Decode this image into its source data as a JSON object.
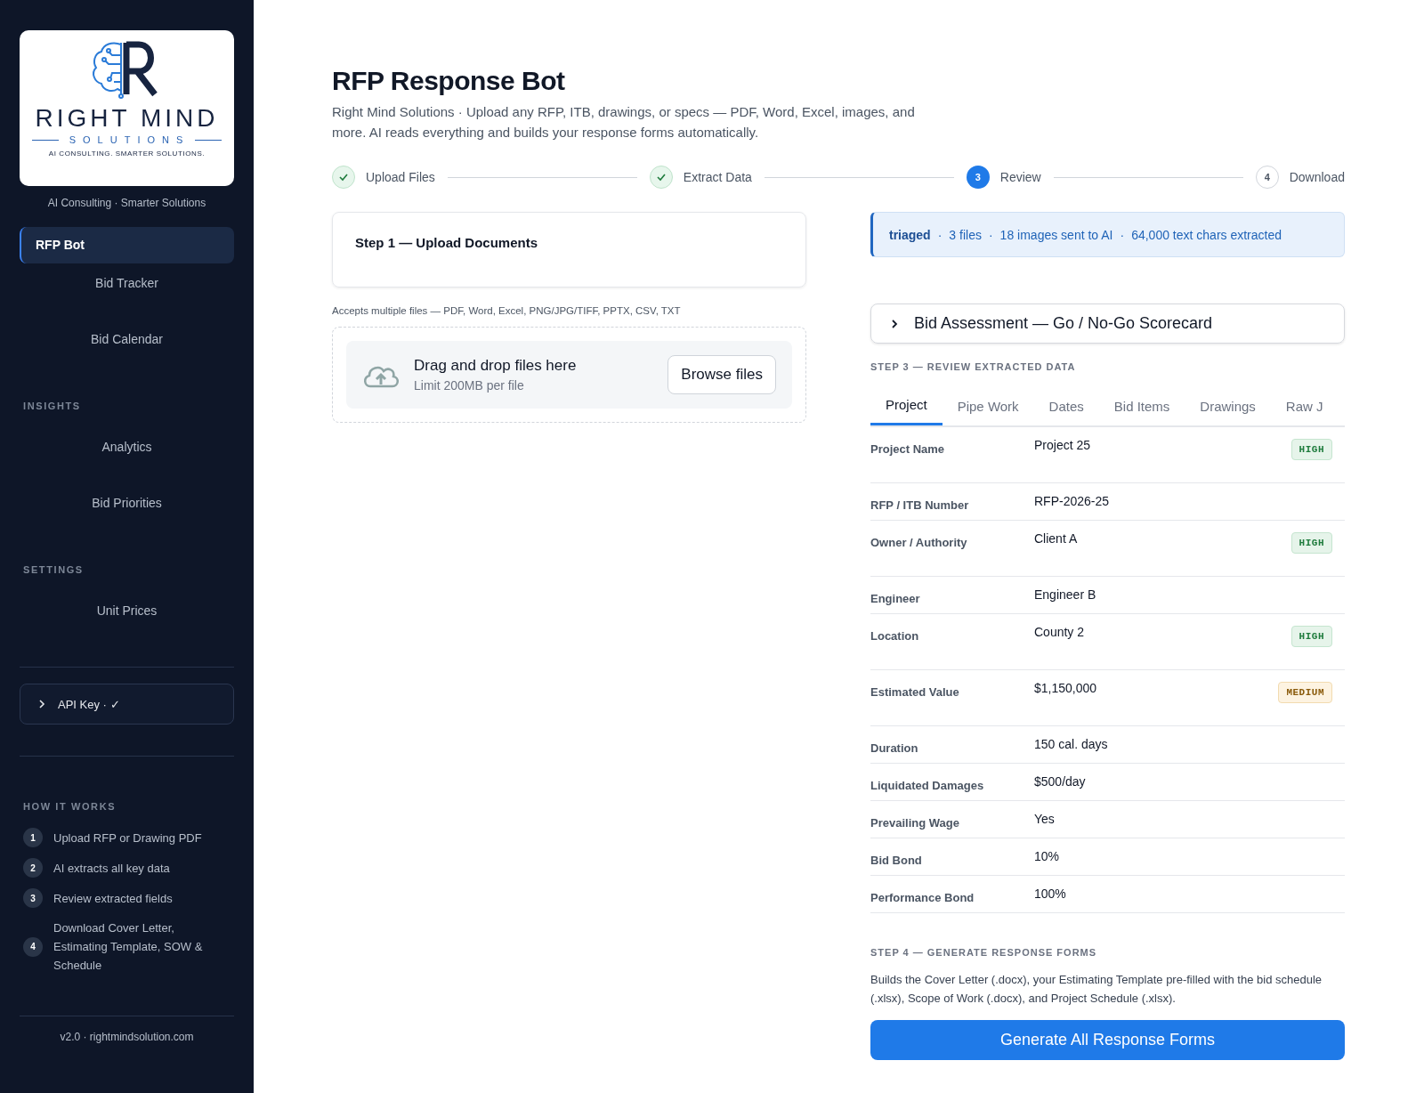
{
  "sidebar": {
    "logo": {
      "wordmark": "RIGHT MIND",
      "subtitle": "SOLUTIONS",
      "motto": "AI CONSULTING. SMARTER SOLUTIONS."
    },
    "tagline": "AI Consulting · Smarter Solutions",
    "nav": [
      {
        "label": "RFP Bot",
        "selected": true
      },
      {
        "label": "Bid Tracker",
        "selected": false
      },
      {
        "label": "Bid Calendar",
        "selected": false
      }
    ],
    "sections": [
      {
        "title": "INSIGHTS",
        "items": [
          {
            "label": "Analytics",
            "selected": false
          },
          {
            "label": "Bid Priorities",
            "selected": false
          }
        ]
      },
      {
        "title": "SETTINGS",
        "items": [
          {
            "label": "Unit Prices",
            "selected": false
          }
        ]
      }
    ],
    "api_key": {
      "label": "API Key · ✓",
      "expanded": false
    },
    "how_it_works": {
      "title": "HOW IT WORKS",
      "steps": [
        {
          "number": "1",
          "text": "Upload RFP or Drawing PDF"
        },
        {
          "number": "2",
          "text": "AI extracts all key data"
        },
        {
          "number": "3",
          "text": "Review extracted fields"
        },
        {
          "number": "4",
          "text": "Download Cover Letter, Estimating Template, SOW & Schedule"
        }
      ]
    },
    "footer": "v2.0 · rightmindsolution.com"
  },
  "main": {
    "title": "RFP Response Bot",
    "subtitle": "Right Mind Solutions · Upload any RFP, ITB, drawings, or specs — PDF, Word, Excel, images, and more. AI reads everything and builds your response forms automatically.",
    "stepper": [
      {
        "label": "Upload Files",
        "kind": "done"
      },
      {
        "label": "Extract Data",
        "kind": "done"
      },
      {
        "number": "3",
        "label": "Review",
        "kind": "current"
      },
      {
        "number": "4",
        "label": "Download",
        "kind": "pending"
      }
    ],
    "upload": {
      "heading": "Step 1 — Upload Documents",
      "accepts": "Accepts multiple files — PDF, Word, Excel, PNG/JPG/TIFF, PPTX, CSV, TXT",
      "dropzone": {
        "title": "Drag and drop files here",
        "limit": "Limit 200MB per file",
        "button": "Browse files"
      }
    },
    "status_banner": {
      "label": "triaged",
      "separator": "·",
      "items": [
        "3 files",
        "18 images sent to AI",
        "64,000 text chars extracted"
      ]
    },
    "scorecard": {
      "label": "Bid Assessment — Go / No-Go Scorecard",
      "expanded": false
    },
    "review": {
      "heading": "STEP 3 — REVIEW EXTRACTED DATA",
      "tabs": [
        {
          "label": "Project",
          "selected": true
        },
        {
          "label": "Pipe Work",
          "selected": false
        },
        {
          "label": "Dates",
          "selected": false
        },
        {
          "label": "Bid Items",
          "selected": false
        },
        {
          "label": "Drawings",
          "selected": false
        },
        {
          "label": "Raw J",
          "selected": false
        }
      ],
      "fields": [
        {
          "label": "Project Name",
          "value": "Project 25",
          "badge": {
            "text": "HIGH",
            "kind": "high"
          }
        },
        {
          "label": "RFP / ITB Number",
          "value": "RFP-2026-25"
        },
        {
          "label": "Owner / Authority",
          "value": "Client A",
          "badge": {
            "text": "HIGH",
            "kind": "high"
          }
        },
        {
          "label": "Engineer",
          "value": "Engineer B"
        },
        {
          "label": "Location",
          "value": "County 2",
          "badge": {
            "text": "HIGH",
            "kind": "high"
          }
        },
        {
          "label": "Estimated Value",
          "value": "$1,150,000",
          "badge": {
            "text": "MEDIUM",
            "kind": "medium"
          }
        },
        {
          "label": "Duration",
          "value": "150 cal. days"
        },
        {
          "label": "Liquidated Damages",
          "value": "$500/day"
        },
        {
          "label": "Prevailing Wage",
          "value": "Yes"
        },
        {
          "label": "Bid Bond",
          "value": "10%"
        },
        {
          "label": "Performance Bond",
          "value": "100%"
        }
      ]
    },
    "generate": {
      "heading": "STEP 4 — GENERATE RESPONSE FORMS",
      "description": "Builds the Cover Letter (.docx), your Estimating Template pre-filled with the bid schedule (.xlsx), Scope of Work (.docx), and Project Schedule (.xlsx).",
      "button": "Generate All Response Forms"
    }
  }
}
